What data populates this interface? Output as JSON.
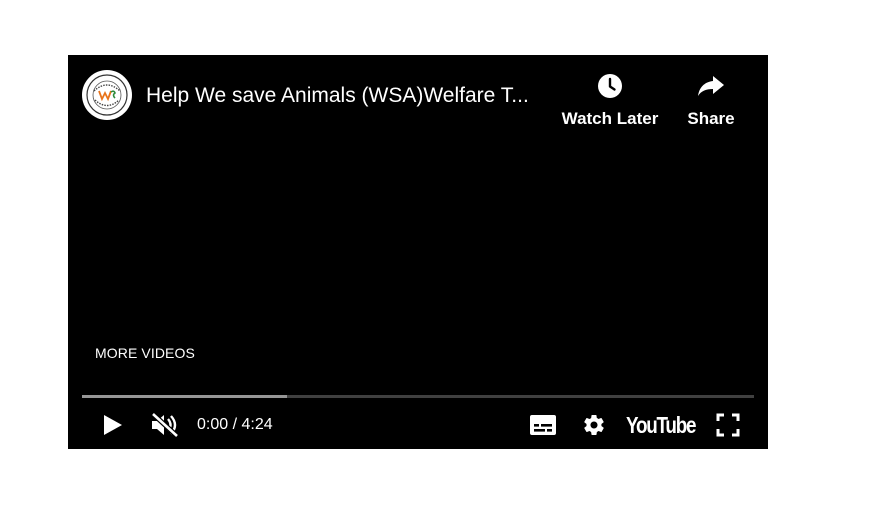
{
  "video": {
    "title": "Help We save Animals (WSA)Welfare T...",
    "channel_avatar_text": "WSA"
  },
  "top_actions": {
    "watch_later_label": "Watch Later",
    "share_label": "Share"
  },
  "more_videos_label": "MORE VIDEOS",
  "playback": {
    "current_time": "0:00",
    "separator": " / ",
    "duration": "4:24",
    "time_text": "0:00 / 4:24",
    "buffered_fraction": 0.305,
    "played_fraction": 0.0,
    "muted": true
  },
  "branding": {
    "logo_text": "YouTube"
  },
  "icons": {
    "avatar": "channel-logo-icon",
    "watch_later": "clock-icon",
    "share": "share-arrow-icon",
    "play": "play-icon",
    "mute": "volume-muted-icon",
    "captions": "subtitles-icon",
    "settings": "gear-icon",
    "fullscreen": "fullscreen-icon"
  },
  "colors": {
    "player_background": "#000000",
    "text": "#ffffff",
    "avatar_accent_orange": "#e8731a",
    "avatar_accent_green": "#2e8b3a"
  }
}
